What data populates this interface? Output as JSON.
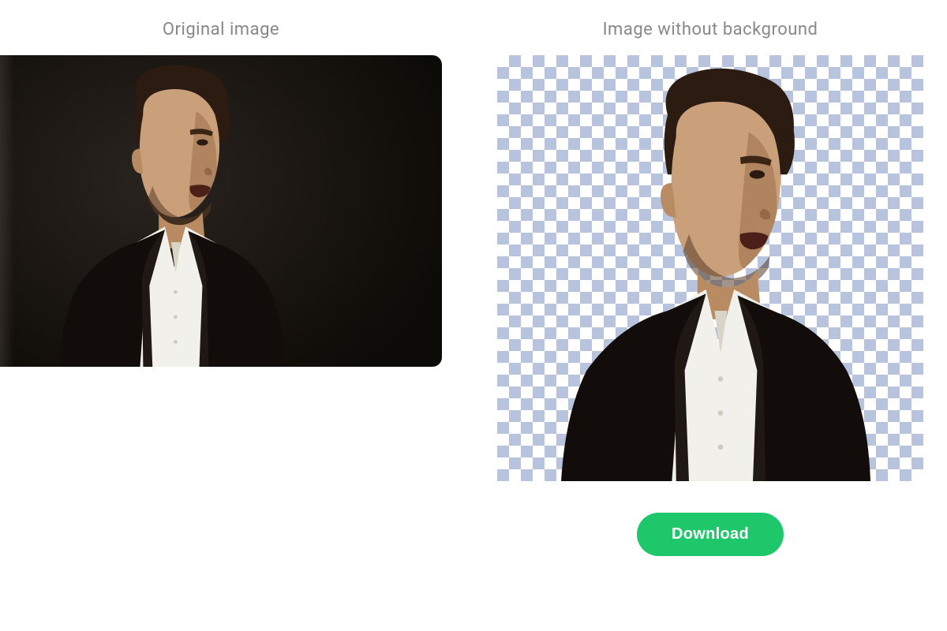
{
  "panels": {
    "original": {
      "title": "Original image"
    },
    "result": {
      "title": "Image without background"
    }
  },
  "actions": {
    "download_label": "Download"
  },
  "colors": {
    "accent": "#1ec76a",
    "checker_dark": "#b8c4de",
    "checker_light": "#ffffff",
    "muted_text": "#888888"
  }
}
